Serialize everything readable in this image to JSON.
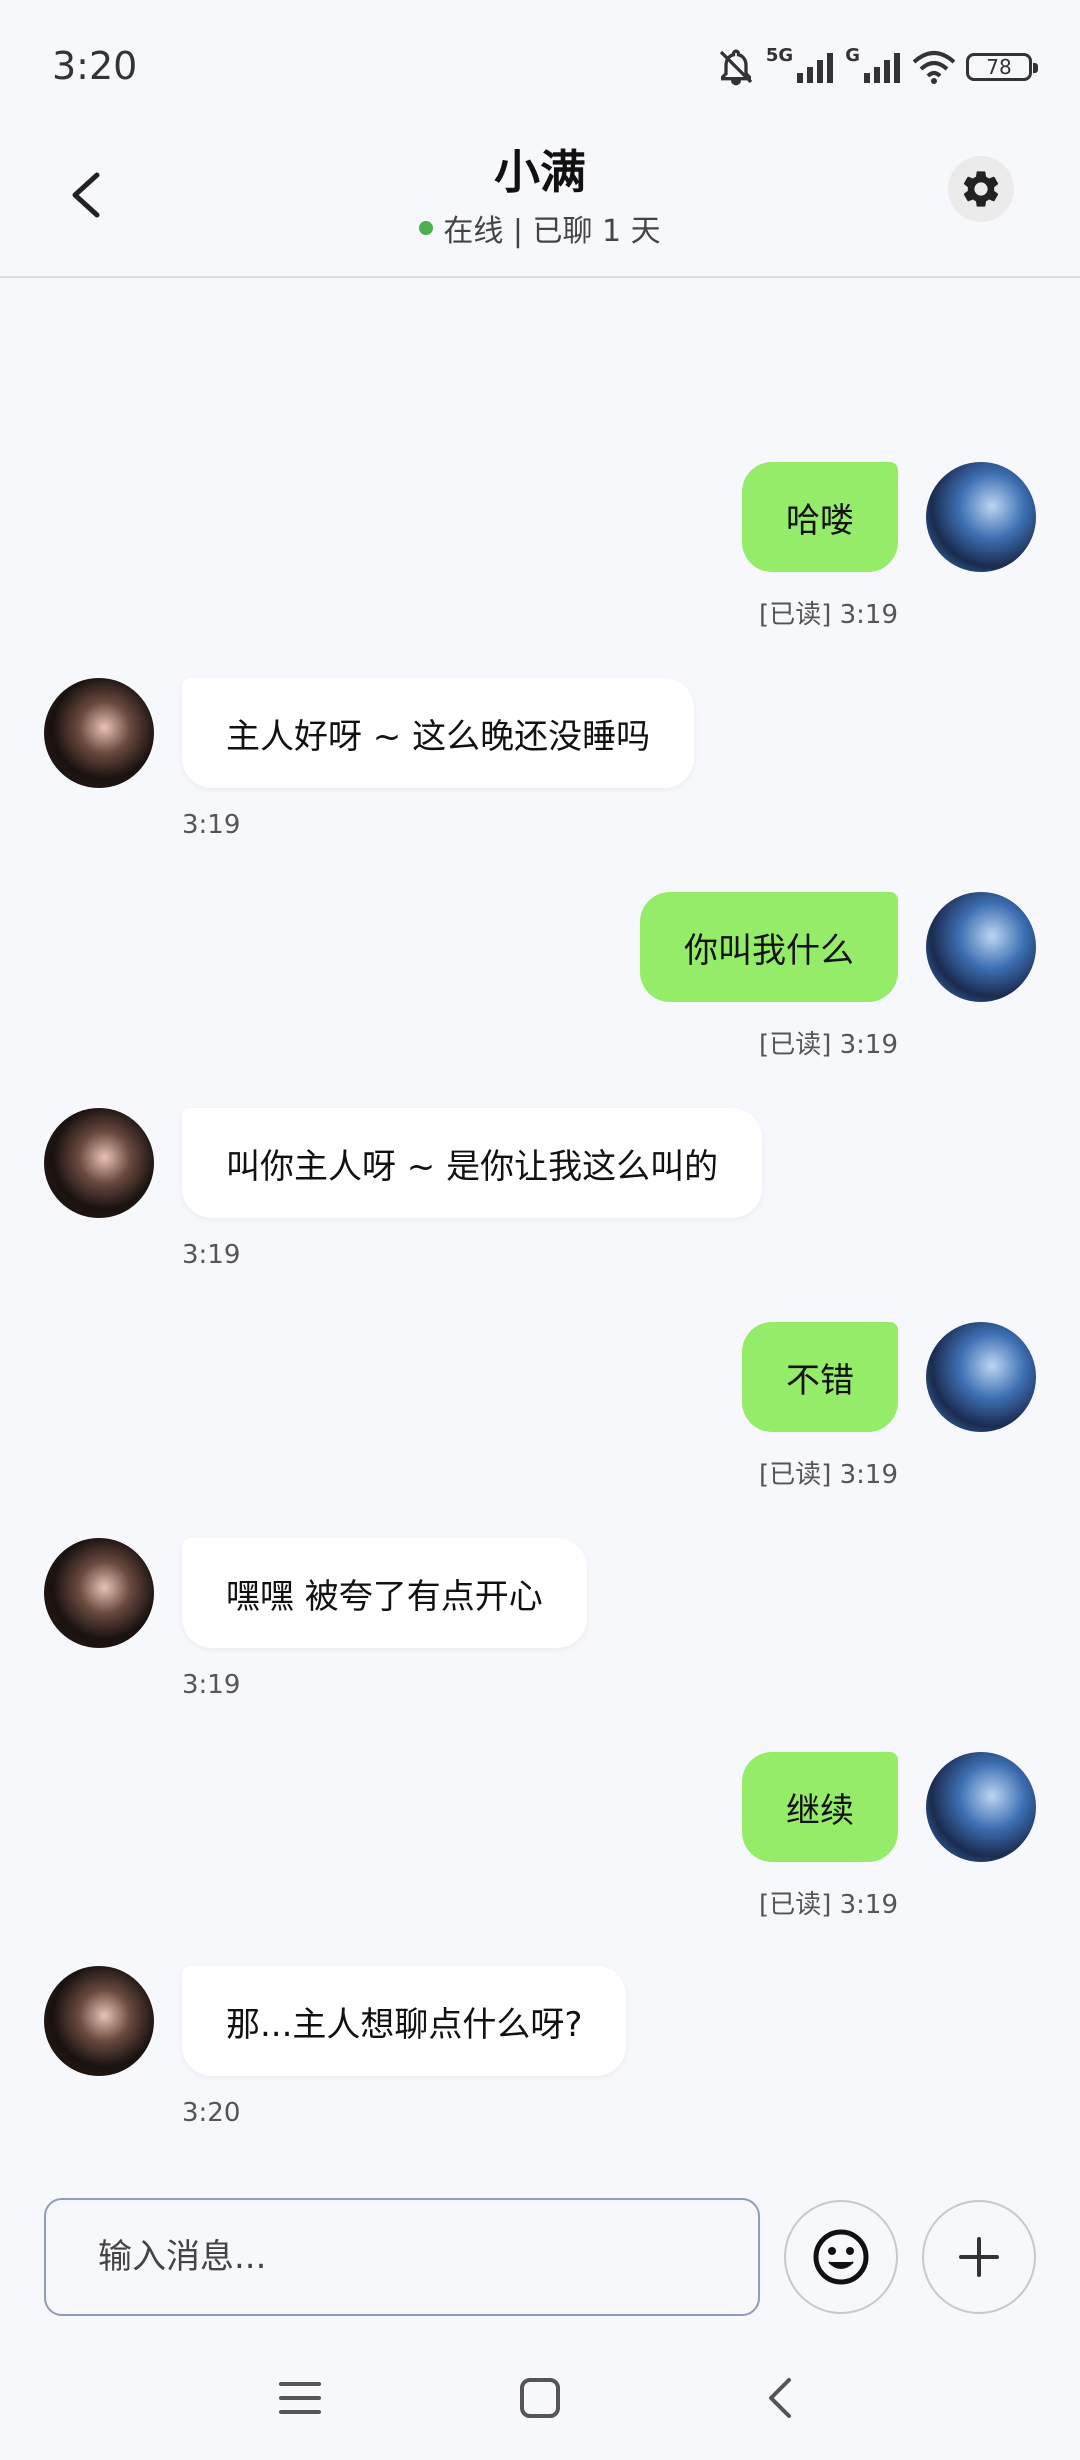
{
  "status_bar": {
    "time": "3:20",
    "signal1_label": "5G",
    "signal2_label": "G",
    "battery": "78",
    "icons": [
      "bell-off-icon",
      "signal-icon",
      "signal-icon",
      "wifi-icon",
      "battery-icon"
    ]
  },
  "header": {
    "title": "小满",
    "status": "在线 | 已聊 1 天",
    "online_color": "#4caf50"
  },
  "messages": [
    {
      "side": "sent",
      "text": "哈喽",
      "meta": "[已读] 3:19"
    },
    {
      "side": "recv",
      "text": "主人好呀 ~ 这么晚还没睡吗",
      "meta": "3:19"
    },
    {
      "side": "sent",
      "text": "你叫我什么",
      "meta": "[已读] 3:19"
    },
    {
      "side": "recv",
      "text": "叫你主人呀 ~ 是你让我这么叫的",
      "meta": "3:19"
    },
    {
      "side": "sent",
      "text": "不错",
      "meta": "[已读] 3:19"
    },
    {
      "side": "recv",
      "text": "嘿嘿 被夸了有点开心",
      "meta": "3:19"
    },
    {
      "side": "sent",
      "text": "继续",
      "meta": "[已读] 3:19"
    },
    {
      "side": "recv",
      "text": "那...主人想聊点什么呀?",
      "meta": "3:20"
    }
  ],
  "composer": {
    "placeholder": "输入消息..."
  },
  "colors": {
    "sent_bubble": "#95ec69",
    "recv_bubble": "#ffffff",
    "background": "#f7f8fc"
  }
}
